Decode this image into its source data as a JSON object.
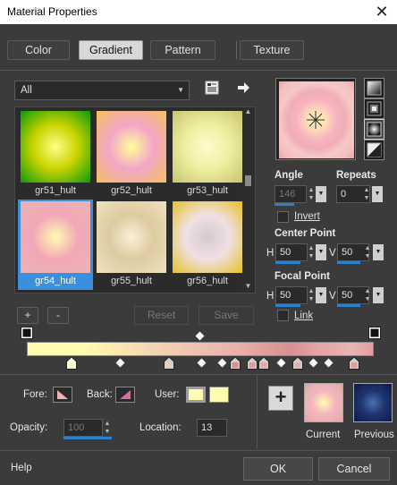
{
  "window": {
    "title": "Material Properties",
    "close_glyph": "✕"
  },
  "tabs": [
    {
      "label": "Color",
      "active": false
    },
    {
      "label": "Gradient",
      "active": true
    },
    {
      "label": "Pattern",
      "active": false
    },
    {
      "label": "Texture",
      "active": false
    }
  ],
  "gradient_panel": {
    "category": "All",
    "swatches": [
      {
        "label": "gr51_hult",
        "selected": false,
        "colors": [
          "#ffff88",
          "#c9d400",
          "#0c9a0c"
        ]
      },
      {
        "label": "gr52_hult",
        "selected": false,
        "colors": [
          "#ffff9a",
          "#f3a6c8",
          "#f3c060"
        ]
      },
      {
        "label": "gr53_hult",
        "selected": false,
        "colors": [
          "#fffbd0",
          "#eef0a0",
          "#c9c470"
        ]
      },
      {
        "label": "gr54_hult",
        "selected": true,
        "colors": [
          "#fffcb0",
          "#f3a7b7",
          "#eab4b4"
        ]
      },
      {
        "label": "gr55_hult",
        "selected": false,
        "colors": [
          "#f9f1d8",
          "#ddcba0",
          "#efe2c0"
        ]
      },
      {
        "label": "gr56_hult",
        "selected": false,
        "colors": [
          "#d6c9ce",
          "#f0e0e3",
          "#e6c028"
        ]
      }
    ],
    "add_label": "+",
    "remove_label": "-",
    "reset_label": "Reset",
    "save_label": "Save"
  },
  "style": {
    "angle_label": "Angle",
    "angle_value": "146",
    "repeats_label": "Repeats",
    "repeats_value": "0",
    "invert_label": "Invert",
    "center_point_label": "Center Point",
    "center_h_label": "H",
    "center_h": "50",
    "center_v_label": "V",
    "center_v": "50",
    "focal_point_label": "Focal Point",
    "focal_h_label": "H",
    "focal_h": "50",
    "focal_v_label": "V",
    "focal_v": "50",
    "link_label": "Link"
  },
  "editor": {
    "fore_label": "Fore:",
    "back_label": "Back:",
    "user_label": "User:",
    "user_color": "#fffcb0",
    "opacity_label": "Opacity:",
    "opacity_value": "100",
    "location_label": "Location:",
    "location_value": "13"
  },
  "current_previous": {
    "add_glyph": "+",
    "current_label": "Current",
    "previous_label": "Previous"
  },
  "footer": {
    "help_label": "Help",
    "ok_label": "OK",
    "cancel_label": "Cancel"
  },
  "colors": {
    "accent_blue": "#2f7fcf",
    "selection_blue": "#3a8fde",
    "dialog_bg": "#3b3b3b"
  }
}
